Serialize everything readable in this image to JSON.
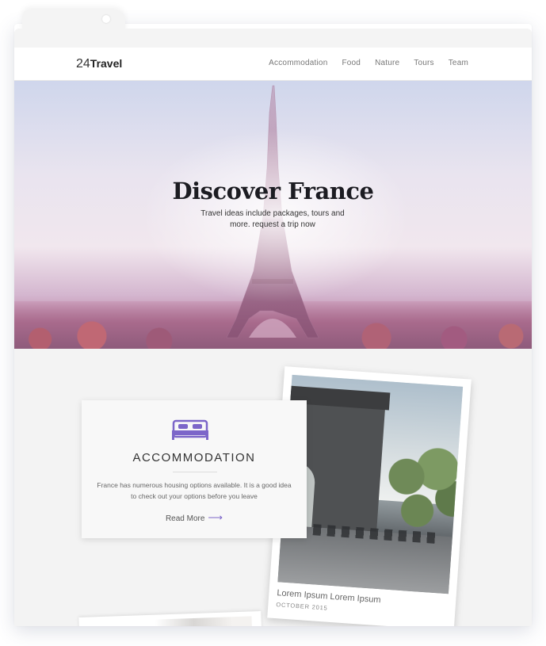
{
  "brand": {
    "number": "24",
    "word": "Travel"
  },
  "nav": {
    "items": [
      "Accommodation",
      "Food",
      "Nature",
      "Tours",
      "Team"
    ]
  },
  "hero": {
    "title": "Discover France",
    "subtitle": "Travel ideas include packages, tours and more. request a trip now"
  },
  "card": {
    "icon": "bed-icon",
    "title": "ACCOMMODATION",
    "text": "France has numerous housing options available. It is a good idea to check out your options before you leave",
    "read_more": "Read More",
    "arrow_icon": "arrow-right-icon"
  },
  "photo": {
    "caption": "Lorem Ipsum Lorem Ipsum",
    "date": "OCTOBER 2015"
  },
  "colors": {
    "accent": "#7c66c9",
    "background": "#f3f3f3",
    "text_dark": "#1c1c22"
  }
}
